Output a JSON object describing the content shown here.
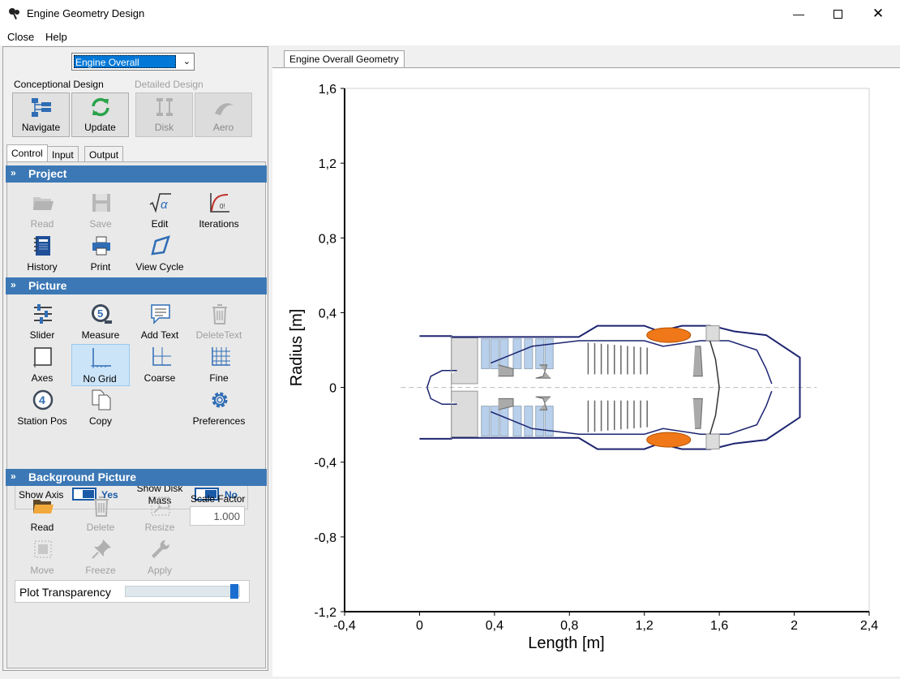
{
  "window": {
    "title": "Engine Geometry Design"
  },
  "menu": [
    "Close",
    "Help"
  ],
  "model_select": {
    "value": "Engine Overall"
  },
  "design_groups": {
    "conceptional": "Conceptional Design",
    "detailed": "Detailed Design"
  },
  "main_buttons": [
    {
      "label": "Navigate",
      "icon": "navigate-icon",
      "enabled": true
    },
    {
      "label": "Update",
      "icon": "update-icon",
      "enabled": true
    },
    {
      "label": "Disk",
      "icon": "disk-icon",
      "enabled": false
    },
    {
      "label": "Aero",
      "icon": "aero-icon",
      "enabled": false
    }
  ],
  "tabs": [
    "Control",
    "Input",
    "Output"
  ],
  "active_tab": "Control",
  "project": {
    "title": "Project",
    "items": [
      {
        "label": "Read",
        "icon": "folder-open-icon",
        "enabled": false
      },
      {
        "label": "Save",
        "icon": "save-icon",
        "enabled": false
      },
      {
        "label": "Edit",
        "icon": "sqrt-alpha-icon",
        "enabled": true
      },
      {
        "label": "Iterations",
        "icon": "iterations-chart-icon",
        "enabled": true
      },
      {
        "label": "History",
        "icon": "notebook-icon",
        "enabled": true
      },
      {
        "label": "Print",
        "icon": "printer-icon",
        "enabled": true
      },
      {
        "label": "View Cycle",
        "icon": "cycle-diagram-icon",
        "enabled": true
      }
    ]
  },
  "picture": {
    "title": "Picture",
    "items": [
      {
        "label": "Slider",
        "icon": "sliders-icon",
        "enabled": true
      },
      {
        "label": "Measure",
        "icon": "measure-tape-icon",
        "enabled": true
      },
      {
        "label": "Add Text",
        "icon": "speech-bubble-icon",
        "enabled": true
      },
      {
        "label": "DeleteText",
        "icon": "trash-icon",
        "enabled": false
      },
      {
        "label": "Axes",
        "icon": "axes-box-icon",
        "enabled": true
      },
      {
        "label": "No Grid",
        "icon": "no-grid-icon",
        "enabled": true,
        "selected": true
      },
      {
        "label": "Coarse",
        "icon": "coarse-grid-icon",
        "enabled": true
      },
      {
        "label": "Fine",
        "icon": "fine-grid-icon",
        "enabled": true
      },
      {
        "label": "Station Pos",
        "icon": "station-number-icon",
        "enabled": true
      },
      {
        "label": "Copy",
        "icon": "copy-icon",
        "enabled": true
      },
      {
        "label": "Preferences",
        "icon": "gear-icon",
        "enabled": true
      }
    ],
    "show_axis": {
      "label": "Show Axis",
      "value": "Yes"
    },
    "show_disk_mass": {
      "label": "Show Disk Mass",
      "value": "No"
    }
  },
  "background_picture": {
    "title": "Background Picture",
    "items": [
      {
        "label": "Read",
        "icon": "folder-icon",
        "enabled": true
      },
      {
        "label": "Delete",
        "icon": "trash-icon",
        "enabled": false
      },
      {
        "label": "Resize",
        "icon": "resize-icon",
        "enabled": false
      },
      {
        "label": "Move",
        "icon": "move-icon",
        "enabled": false
      },
      {
        "label": "Freeze",
        "icon": "pin-icon",
        "enabled": false
      },
      {
        "label": "Apply",
        "icon": "wrench-icon",
        "enabled": false
      }
    ],
    "scale_factor": {
      "label": "Scale Factor",
      "value": "1.000"
    },
    "plot_transparency": {
      "label": "Plot Transparency",
      "value": 0.95
    }
  },
  "plot_tab": "Engine Overall Geometry",
  "chart_data": {
    "type": "diagram",
    "xlabel": "Length [m]",
    "ylabel": "Radius [m]",
    "xlim": [
      -0.4,
      2.4
    ],
    "ylim": [
      -1.2,
      1.6
    ],
    "xticks": [
      "-0,4",
      "0",
      "0,4",
      "0,8",
      "1,2",
      "1,6",
      "2",
      "2,4"
    ],
    "yticks": [
      "1,6",
      "1,2",
      "0,8",
      "0,4",
      "0",
      "-0,4",
      "-0,8",
      "-1,2"
    ],
    "grid": false,
    "colors": {
      "outline": "#1c2470",
      "combustor": "#f07818",
      "casing_fill": "#dcdcdc",
      "blade_fill": "#b8d0ec"
    }
  }
}
